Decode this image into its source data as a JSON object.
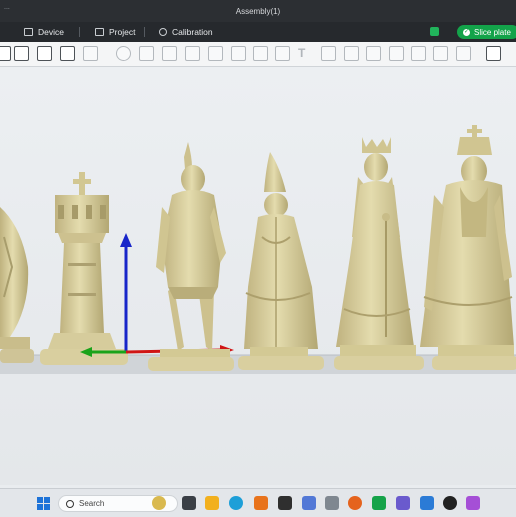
{
  "window": {
    "title": "Assembly(1)",
    "corner_text": "..."
  },
  "nav": {
    "tabs": [
      {
        "label": "Device",
        "icon": "device-icon"
      },
      {
        "label": "Project",
        "icon": "project-icon"
      },
      {
        "label": "Calibration",
        "icon": "calibration-icon"
      }
    ],
    "slice_button": "Slice plate"
  },
  "toolbar": {
    "tools": [
      "add-icon",
      "add-plate-icon",
      "orient-icon",
      "arrange-icon",
      "layers-icon",
      "move-icon",
      "rotate-icon",
      "scale-icon",
      "lay-on-face-icon",
      "cut-icon",
      "split-icon",
      "support-paint-icon",
      "seam-paint-icon",
      "text-icon",
      "measure-icon",
      "assembly-icon",
      "boolean-icon",
      "variable-layer-icon",
      "color-paint-icon"
    ],
    "text_tool_label": "T"
  },
  "scene": {
    "pieces": [
      "bishop-partial",
      "rook",
      "knight",
      "bishop",
      "queen",
      "king"
    ],
    "colors": {
      "material": "#d8cf9e",
      "shadow": "#b9ae7c",
      "plate": "#cfd3d6",
      "x_axis": "#d01515",
      "y_axis": "#1aa31a",
      "z_axis": "#1725c9"
    }
  },
  "taskbar": {
    "search_label": "Search",
    "apps": [
      "files-icon",
      "explorer-icon",
      "edge-icon",
      "fusion-icon",
      "chess-icon",
      "calc-icon",
      "calculator-icon",
      "firefox-icon",
      "orca-icon",
      "3d-icon",
      "paint-icon",
      "video-icon",
      "photos-icon"
    ]
  }
}
